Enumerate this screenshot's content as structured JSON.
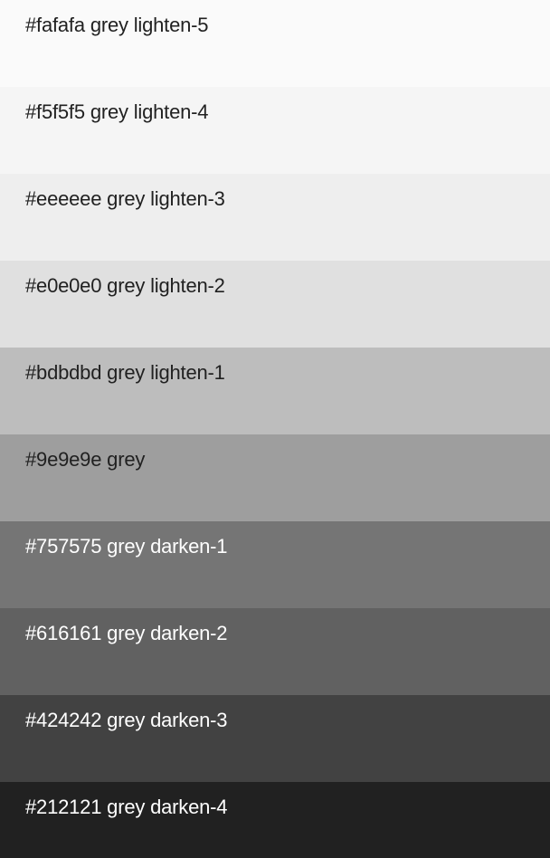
{
  "swatches": [
    {
      "hex": "#fafafa",
      "label": "grey lighten-5",
      "text_color": "#212121"
    },
    {
      "hex": "#f5f5f5",
      "label": "grey lighten-4",
      "text_color": "#212121"
    },
    {
      "hex": "#eeeeee",
      "label": "grey lighten-3",
      "text_color": "#212121"
    },
    {
      "hex": "#e0e0e0",
      "label": "grey lighten-2",
      "text_color": "#212121"
    },
    {
      "hex": "#bdbdbd",
      "label": "grey lighten-1",
      "text_color": "#212121"
    },
    {
      "hex": "#9e9e9e",
      "label": "grey",
      "text_color": "#212121"
    },
    {
      "hex": "#757575",
      "label": "grey darken-1",
      "text_color": "#ffffff"
    },
    {
      "hex": "#616161",
      "label": "grey darken-2",
      "text_color": "#ffffff"
    },
    {
      "hex": "#424242",
      "label": "grey darken-3",
      "text_color": "#ffffff"
    },
    {
      "hex": "#212121",
      "label": "grey darken-4",
      "text_color": "#ffffff"
    }
  ]
}
